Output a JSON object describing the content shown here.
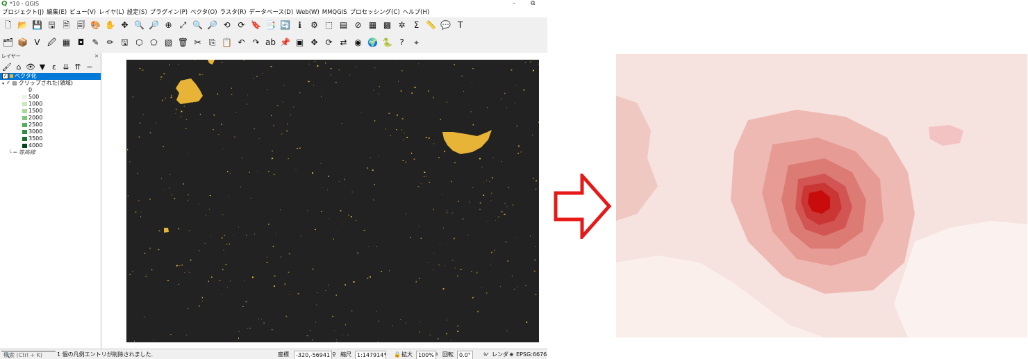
{
  "window": {
    "title": "*10 - QGIS",
    "minimize": "–",
    "restore": "⧉"
  },
  "menu": [
    "プロジェクト(J)",
    "編集(E)",
    "ビュー(V)",
    "レイヤ(L)",
    "設定(S)",
    "プラグイン(P)",
    "ベクタ(O)",
    "ラスタ(R)",
    "データベース(D)",
    "Web(W)",
    "MMQGIS",
    "プロセッシング(C)",
    "ヘルプ(H)"
  ],
  "toolbar1": [
    {
      "name": "new-project-icon",
      "glyph": "🗋"
    },
    {
      "name": "open-project-icon",
      "glyph": "📂"
    },
    {
      "name": "save-project-icon",
      "glyph": "💾"
    },
    {
      "name": "save-as-icon",
      "glyph": "🖫"
    },
    {
      "name": "new-print-layout-icon",
      "glyph": "🗎"
    },
    {
      "name": "layout-manager-icon",
      "glyph": "🗐"
    },
    {
      "name": "style-manager-icon",
      "glyph": "🎨"
    },
    {
      "name": "pan-icon",
      "glyph": "✋"
    },
    {
      "name": "pan-to-selection-icon",
      "glyph": "✥"
    },
    {
      "name": "zoom-in-icon",
      "glyph": "🔍"
    },
    {
      "name": "zoom-out-icon",
      "glyph": "🔎"
    },
    {
      "name": "zoom-native-icon",
      "glyph": "⊕"
    },
    {
      "name": "zoom-full-icon",
      "glyph": "⤢"
    },
    {
      "name": "zoom-selection-icon",
      "glyph": "🔍"
    },
    {
      "name": "zoom-layer-icon",
      "glyph": "🔎"
    },
    {
      "name": "zoom-last-icon",
      "glyph": "⟲"
    },
    {
      "name": "zoom-next-icon",
      "glyph": "⟳"
    },
    {
      "name": "new-bookmark-icon",
      "glyph": "🔖"
    },
    {
      "name": "show-bookmarks-icon",
      "glyph": "📑"
    },
    {
      "name": "refresh-icon",
      "glyph": "🔄"
    },
    {
      "name": "identify-icon",
      "glyph": "ℹ"
    },
    {
      "name": "run-action-icon",
      "glyph": "⚙"
    },
    {
      "name": "select-features-icon",
      "glyph": "⬚"
    },
    {
      "name": "select-by-value-icon",
      "glyph": "▤"
    },
    {
      "name": "deselect-icon",
      "glyph": "⊘"
    },
    {
      "name": "attribute-table-icon",
      "glyph": "▦"
    },
    {
      "name": "field-calculator-icon",
      "glyph": "▩"
    },
    {
      "name": "toolbox-icon",
      "glyph": "✲"
    },
    {
      "name": "statistics-icon",
      "glyph": "Σ"
    },
    {
      "name": "measure-icon",
      "glyph": "📏"
    },
    {
      "name": "map-tips-icon",
      "glyph": "💬"
    },
    {
      "name": "text-annotation-icon",
      "glyph": "T"
    }
  ],
  "toolbar2": [
    {
      "name": "data-source-manager-icon",
      "glyph": "🗂"
    },
    {
      "name": "new-layer-icon",
      "glyph": "📦"
    },
    {
      "name": "add-vector-icon",
      "glyph": "V"
    },
    {
      "name": "add-raster-icon",
      "glyph": "🖉"
    },
    {
      "name": "add-mesh-icon",
      "glyph": "▦"
    },
    {
      "name": "panel-toggle-icon",
      "glyph": "◘"
    },
    {
      "name": "digitize-icon",
      "glyph": "✎"
    },
    {
      "name": "toggle-editing-icon",
      "glyph": "✏"
    },
    {
      "name": "save-edits-icon",
      "glyph": "🖫"
    },
    {
      "name": "add-feature-icon",
      "glyph": "⬡"
    },
    {
      "name": "vertex-tool-icon",
      "glyph": "⬠"
    },
    {
      "name": "modify-attributes-icon",
      "glyph": "▧"
    },
    {
      "name": "delete-selected-icon",
      "glyph": "🗑"
    },
    {
      "name": "cut-features-icon",
      "glyph": "✂"
    },
    {
      "name": "copy-features-icon",
      "glyph": "⎘"
    },
    {
      "name": "paste-features-icon",
      "glyph": "📋"
    },
    {
      "name": "undo-icon",
      "glyph": "↶"
    },
    {
      "name": "redo-icon",
      "glyph": "↷"
    },
    {
      "name": "label-icon",
      "glyph": "ab"
    },
    {
      "name": "label-pin-icon",
      "glyph": "📌"
    },
    {
      "name": "label-highlight-icon",
      "glyph": "▣"
    },
    {
      "name": "label-move-icon",
      "glyph": "✥"
    },
    {
      "name": "label-rotate-icon",
      "glyph": "⟳"
    },
    {
      "name": "label-change-icon",
      "glyph": "⇄"
    },
    {
      "name": "label-show-icon",
      "glyph": "◉"
    },
    {
      "name": "georeferencer-icon",
      "glyph": "🌍"
    },
    {
      "name": "python-console-icon",
      "glyph": "🐍"
    },
    {
      "name": "help-icon",
      "glyph": "?"
    },
    {
      "name": "gps-icon",
      "glyph": "⌖"
    }
  ],
  "layers_panel": {
    "title": "レイヤー",
    "close": "✕",
    "tools": [
      {
        "name": "style-panel-icon",
        "glyph": "🖌"
      },
      {
        "name": "add-group-icon",
        "glyph": "⌂"
      },
      {
        "name": "manage-visibility-icon",
        "glyph": "👁"
      },
      {
        "name": "filter-legend-icon",
        "glyph": "▼"
      },
      {
        "name": "filter-expression-icon",
        "glyph": "ε"
      },
      {
        "name": "expand-all-icon",
        "glyph": "⇊"
      },
      {
        "name": "collapse-all-icon",
        "glyph": "⇈"
      },
      {
        "name": "remove-layer-icon",
        "glyph": "−"
      }
    ],
    "layers": [
      {
        "label": "ベクタ化",
        "checked": "✓",
        "selected": true
      },
      {
        "label": "クリップされた(領域)",
        "checked": "✓",
        "selected": false
      }
    ],
    "legend": [
      {
        "label": "0",
        "color": "#ffffff"
      },
      {
        "label": "500",
        "color": "#e8f5e0"
      },
      {
        "label": "1000",
        "color": "#c8e8bd"
      },
      {
        "label": "1500",
        "color": "#a6da98"
      },
      {
        "label": "2000",
        "color": "#7cc877"
      },
      {
        "label": "2500",
        "color": "#4cb05a"
      },
      {
        "label": "3000",
        "color": "#2b8f3e"
      },
      {
        "label": "3500",
        "color": "#15702c"
      },
      {
        "label": "4000",
        "color": "#00441b"
      }
    ],
    "contour_layer": "等高線"
  },
  "status": {
    "search_placeholder": "検索 (Ctrl + K)",
    "message": "1 個の凡例エントリが削除されました.",
    "coord_label": "座標",
    "coord_value": "-320,-56941",
    "scale_label": "縮尺",
    "scale_value": "1:147914",
    "magnifier_label": "拡大",
    "magnifier_value": "100%",
    "rotation_label": "回転",
    "rotation_value": "0.0°",
    "render_label": "レンダ",
    "crs": "EPSG:6676"
  },
  "colors": {
    "map_background": "#222222",
    "vector_fill": "#e8b437",
    "arrow_stroke": "#e61919",
    "heat_low": "#f4dcd8",
    "heat_high": "#cc0000",
    "selection": "#0078d7"
  }
}
